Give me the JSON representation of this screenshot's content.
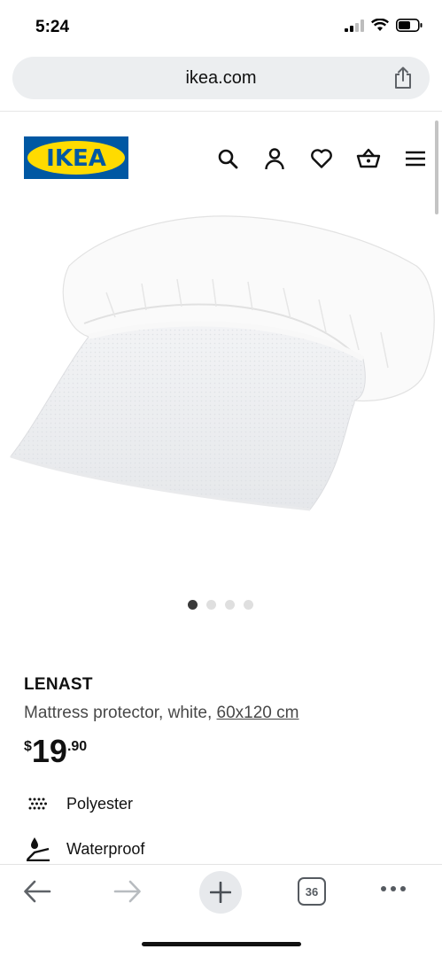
{
  "status": {
    "time": "5:24"
  },
  "browser": {
    "url": "ikea.com",
    "tab_count": "36"
  },
  "header": {
    "logo_text": "IKEA",
    "brand_blue": "#0058a3",
    "brand_yellow": "#ffdb00"
  },
  "carousel": {
    "count": 4,
    "active": 1
  },
  "product": {
    "name": "LENAST",
    "description": "Mattress protector, white, ",
    "size": "60x120 cm",
    "price_currency": "$",
    "price_int": "19",
    "price_dec": ".90",
    "features": [
      {
        "icon": "polyester-icon",
        "label": "Polyester"
      },
      {
        "icon": "waterproof-icon",
        "label": "Waterproof"
      }
    ]
  }
}
